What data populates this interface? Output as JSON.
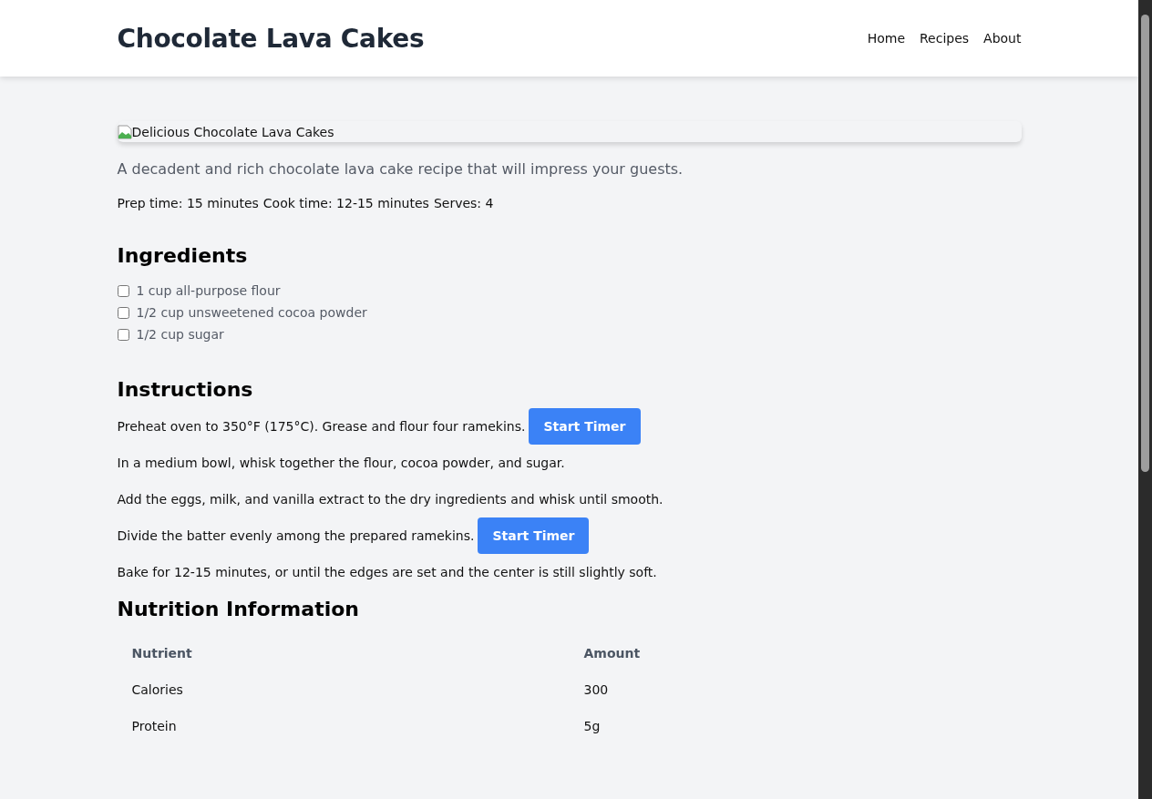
{
  "header": {
    "title": "Chocolate Lava Cakes",
    "nav": [
      {
        "label": "Home"
      },
      {
        "label": "Recipes"
      },
      {
        "label": "About"
      }
    ]
  },
  "hero_image": {
    "alt": "Delicious Chocolate Lava Cakes"
  },
  "description": "A decadent and rich chocolate lava cake recipe that will impress your guests.",
  "meta": [
    "Prep time: 15 minutes",
    "Cook time: 12-15 minutes",
    "Serves: 4"
  ],
  "ingredients": {
    "heading": "Ingredients",
    "items": [
      {
        "label": "1 cup all-purpose flour",
        "checked": false
      },
      {
        "label": "1/2 cup unsweetened cocoa powder",
        "checked": false
      },
      {
        "label": "1/2 cup sugar",
        "checked": false
      }
    ]
  },
  "instructions": {
    "heading": "Instructions",
    "steps": [
      {
        "text": "Preheat oven to 350°F (175°C). Grease and flour four ramekins.",
        "button": "Start Timer"
      },
      {
        "text": "In a medium bowl, whisk together the flour, cocoa powder, and sugar."
      },
      {
        "text": "Add the eggs, milk, and vanilla extract to the dry ingredients and whisk until smooth."
      },
      {
        "text": "Divide the batter evenly among the prepared ramekins.",
        "button": "Start Timer"
      },
      {
        "text": "Bake for 12-15 minutes, or until the edges are set and the center is still slightly soft."
      }
    ]
  },
  "nutrition": {
    "heading": "Nutrition Information",
    "columns": [
      "Nutrient",
      "Amount"
    ],
    "rows": [
      [
        "Calories",
        "300"
      ],
      [
        "Protein",
        "5g"
      ]
    ]
  }
}
